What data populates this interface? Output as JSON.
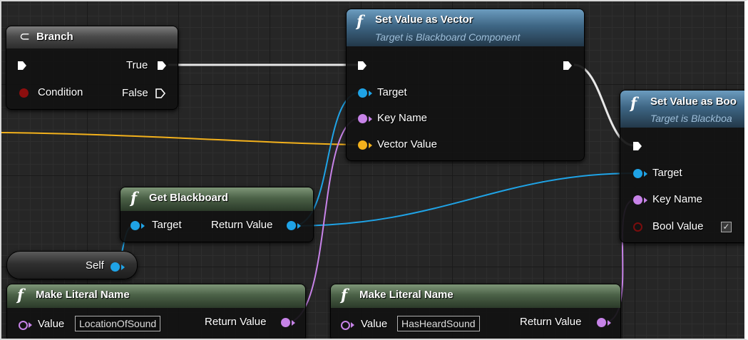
{
  "branch": {
    "title": "Branch",
    "true_label": "True",
    "false_label": "False",
    "condition_label": "Condition"
  },
  "set_vector": {
    "title": "Set Value as Vector",
    "subtitle": "Target is Blackboard Component",
    "target_label": "Target",
    "keyname_label": "Key Name",
    "value_label": "Vector Value"
  },
  "set_bool": {
    "title": "Set Value as Boo",
    "subtitle": "Target is Blackboa",
    "target_label": "Target",
    "keyname_label": "Key Name",
    "value_label": "Bool Value",
    "checked": "✓"
  },
  "get_blackboard": {
    "title": "Get Blackboard",
    "target_label": "Target",
    "return_label": "Return Value"
  },
  "self_node": {
    "label": "Self"
  },
  "literal_1": {
    "title": "Make Literal Name",
    "value_label": "Value",
    "value": "LocationOfSound",
    "return_label": "Return Value"
  },
  "literal_2": {
    "title": "Make Literal Name",
    "value_label": "Value",
    "value": "HasHeardSound",
    "return_label": "Return Value"
  },
  "icons": {
    "function": "f"
  },
  "colors": {
    "exec": "#ffffff",
    "object": "#1fa3e6",
    "name": "#c783e8",
    "vector": "#f3b11c",
    "bool": "#8c0e0e"
  }
}
